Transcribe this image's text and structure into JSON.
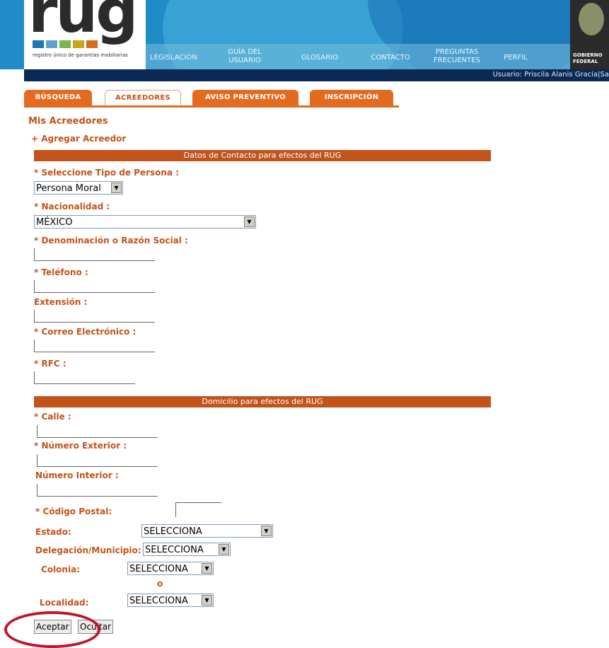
{
  "logo": {
    "text": "rug",
    "tagline": "registro único de garantías mobiliarias",
    "squares": [
      "#1c74b9",
      "#5aa0d6",
      "#7ab648",
      "#c9a418",
      "#d96b1f"
    ]
  },
  "nav": {
    "items": [
      "LEGISLACIÓN",
      "GUÍA DEL USUARIO",
      "GLOSARIO",
      "CONTACTO",
      "PREGUNTAS FRECUENTES",
      "PERFIL"
    ],
    "gov_label": "GOBIERNO FEDERAL"
  },
  "user_bar": {
    "text": "Usuario: Priscila Alanis Gracia|Sa"
  },
  "tabs": [
    {
      "label": "BÚSQUEDA",
      "active": false
    },
    {
      "label": "ACREEDORES",
      "active": true
    },
    {
      "label": "AVISO PREVENTIVO",
      "active": false
    },
    {
      "label": "INSCRIPCIÓN",
      "active": false
    }
  ],
  "page": {
    "title": "Mis Acreedores",
    "add_link": "+ Agregar Acreedor"
  },
  "contact_section": {
    "header": "Datos de Contacto para efectos del RUG",
    "tipo_persona_label": "* Seleccione Tipo de Persona :",
    "tipo_persona_value": "Persona Moral",
    "nacionalidad_label": "* Nacionalidad :",
    "nacionalidad_value": "MÉXICO",
    "denominacion_label": "* Denominación o Razón Social :",
    "telefono_label": "* Teléfono :",
    "extension_label": "Extensión :",
    "correo_label": "* Correo Electrónico :",
    "rfc_label": "* RFC :"
  },
  "address_section": {
    "header": "Domicilio para efectos del RUG",
    "calle_label": "* Calle :",
    "num_ext_label": "* Número Exterior :",
    "num_int_label": "Número Interior :",
    "cp_label": "* Código Postal:",
    "estado_label": "Estado:",
    "estado_value": "SELECCIONA",
    "delegacion_label": "Delegación/Municipio:",
    "delegacion_value": "SELECCIONA",
    "colonia_label": "Colonia:",
    "colonia_value": "SELECCIONA",
    "o_text": "o",
    "localidad_label": "Localidad:",
    "localidad_value": "SELECCIONA"
  },
  "buttons": {
    "accept": "Aceptar",
    "hide": "Ocultar"
  },
  "colors": {
    "accent": "#c2541b",
    "tab": "#e26b1f",
    "highlight": "#c0142c",
    "user_bar": "#0a2a55"
  }
}
